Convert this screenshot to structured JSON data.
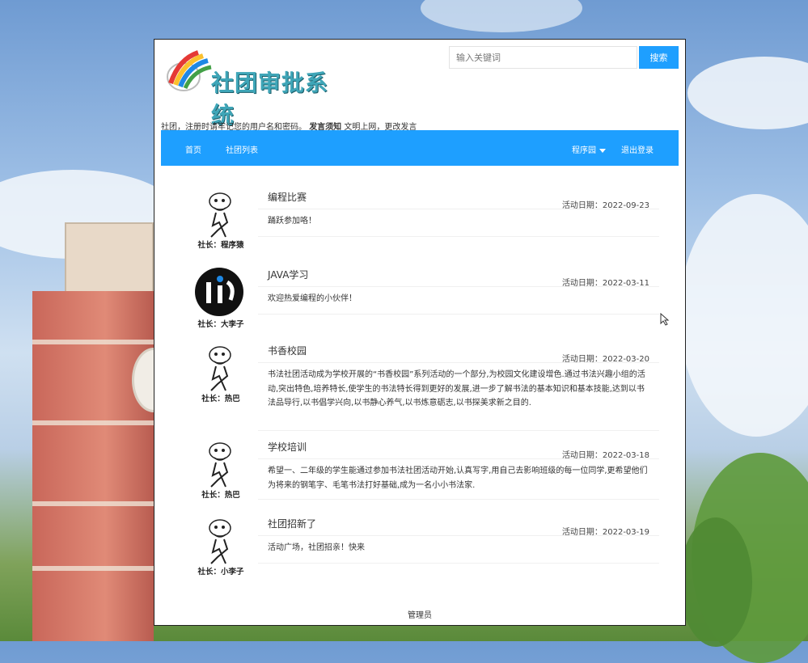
{
  "header": {
    "logo_text": "社团审批系统",
    "search_placeholder": "输入关键词",
    "search_button": "搜索"
  },
  "notice": {
    "prefix": "社团，注册时请牢记您的用户名和密码。",
    "bold": "发言须知",
    "suffix": "文明上网，更改发言"
  },
  "nav": {
    "home": "首页",
    "club_list": "社团列表",
    "user": "程序园",
    "logout": "退出登录"
  },
  "posts": [
    {
      "author": "社长：程序猿",
      "title": "编程比赛",
      "date": "活动日期：2022-09-23",
      "content": "踊跃参加咯！",
      "avatar": "sketch"
    },
    {
      "author": "社长：大李子",
      "title": "JAVA学习",
      "date": "活动日期：2022-03-11",
      "content": "欢迎热爱编程的小伙伴！",
      "avatar": "logo"
    },
    {
      "author": "社长：热巴",
      "title": "书香校园",
      "date": "活动日期：2022-03-20",
      "content": "书法社团活动成为学校开展的“书香校园”系列活动的一个部分,为校园文化建设增色.通过书法兴趣小组的活动,突出特色,培养特长,使学生的书法特长得到更好的发展,进一步了解书法的基本知识和基本技能,达到以书法品导行,以书倡学兴向,以书静心养气,以书炼意砺志,以书探美求新之目的.",
      "avatar": "sketch"
    },
    {
      "author": "社长：热巴",
      "title": "学校培训",
      "date": "活动日期：2022-03-18",
      "content": "希望一、二年级的学生能通过参加书法社团活动开始,认真写字,用自己去影响班级的每一位同学,更希望他们为将来的钢笔字、毛笔书法打好基础,成为一名小小书法家.",
      "avatar": "sketch"
    },
    {
      "author": "社长：小李子",
      "title": "社团招新了",
      "date": "活动日期：2022-03-19",
      "content": "活动广场，社团招亲！快来",
      "avatar": "sketch"
    }
  ],
  "footer": "管理员",
  "colors": {
    "accent": "#1e9fff",
    "logo": "#3fa6b8"
  }
}
